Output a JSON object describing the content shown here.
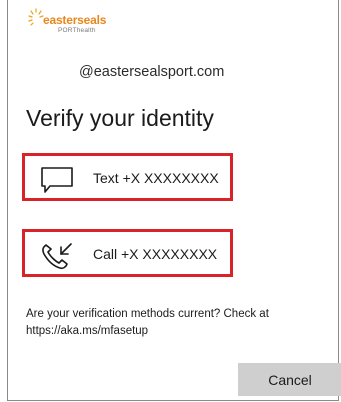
{
  "logo": {
    "brand": "easterseals",
    "sub": "PORThealth"
  },
  "account": "@eastersealsport.com",
  "title": "Verify your identity",
  "options": [
    {
      "icon": "chat-bubble-icon",
      "label": "Text +X XXXXXXXX"
    },
    {
      "icon": "phone-call-icon",
      "label": "Call +X XXXXXXXX"
    }
  ],
  "note": "Are your verification methods current? Check at https://aka.ms/mfasetup",
  "cancel_label": "Cancel",
  "colors": {
    "accent_border": "#d8232a",
    "brand_orange": "#e8871c",
    "cancel_bg": "#cfcfcf"
  }
}
